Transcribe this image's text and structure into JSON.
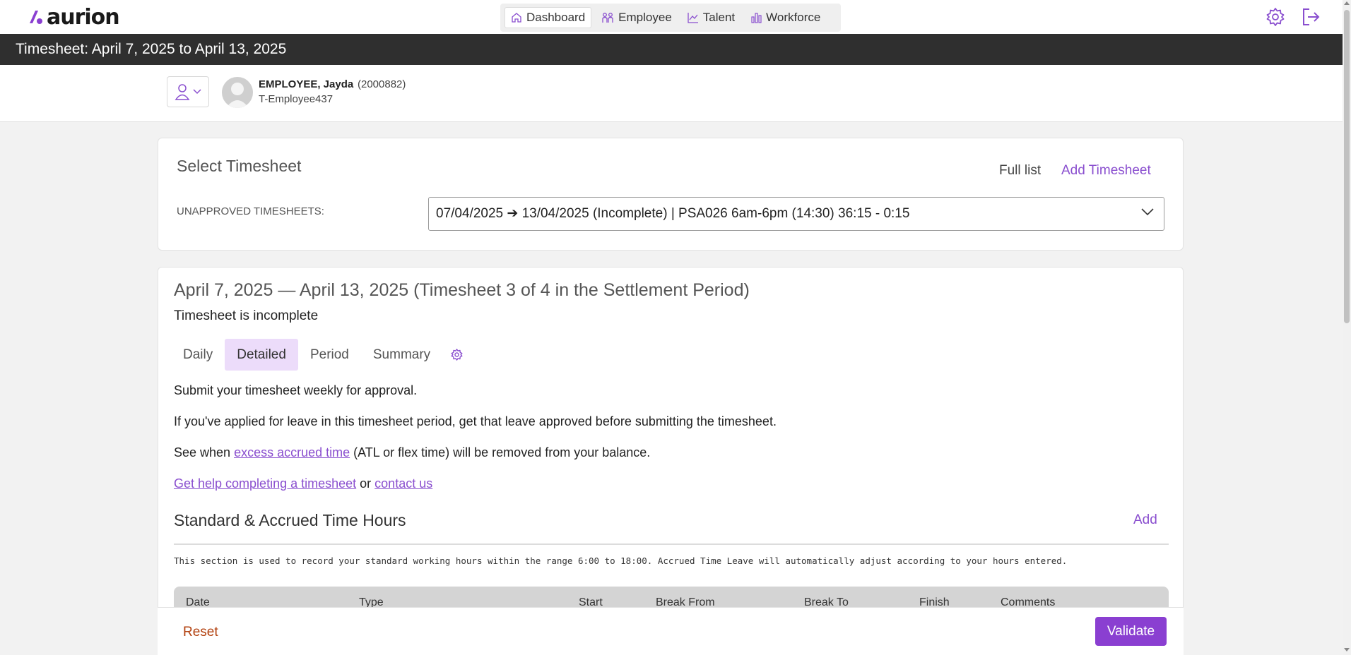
{
  "brand": {
    "logo_text": "aurion",
    "accent": "#8a4fcf",
    "button_color": "#8a3fd1"
  },
  "nav": {
    "items": [
      {
        "label": "Dashboard",
        "icon": "home-icon",
        "active": true
      },
      {
        "label": "Employee",
        "icon": "people-icon",
        "active": false
      },
      {
        "label": "Talent",
        "icon": "trend-chart-icon",
        "active": false
      },
      {
        "label": "Workforce",
        "icon": "bar-chart-icon",
        "active": false
      }
    ],
    "settings_icon": "gear-icon",
    "logout_icon": "logout-icon"
  },
  "page_title": "Timesheet: April 7, 2025 to April 13, 2025",
  "employee": {
    "name": "EMPLOYEE, Jayda",
    "id": "(2000882)",
    "code": "T-Employee437"
  },
  "select_timesheet": {
    "title": "Select Timesheet",
    "full_list": "Full list",
    "add_timesheet": "Add Timesheet",
    "unapproved_label": "UNAPPROVED TIMESHEETS:",
    "selected": "07/04/2025 ➔ 13/04/2025 (Incomplete) | PSA026 6am-6pm (14:30) 36:15 - 0:15"
  },
  "timesheet": {
    "title": "April 7, 2025 — April 13, 2025 (Timesheet 3 of 4 in the Settlement Period)",
    "status": "Timesheet is incomplete",
    "tabs": [
      {
        "label": "Daily",
        "active": false
      },
      {
        "label": "Detailed",
        "active": true
      },
      {
        "label": "Period",
        "active": false
      },
      {
        "label": "Summary",
        "active": false
      }
    ],
    "info": {
      "line1": "Submit your timesheet weekly for approval.",
      "line2": "If you've applied for leave in this timesheet period, get that leave approved before submitting the timesheet.",
      "line3_prefix": "See when ",
      "line3_link": "excess accrued time",
      "line3_suffix": " (ATL or flex time) will be removed from your balance.",
      "help_link": "Get help completing a timesheet",
      "or": " or ",
      "contact_link": "contact us"
    },
    "section": {
      "title": "Standard & Accrued Time Hours",
      "add": "Add",
      "note": "This section is used to record your standard working hours within the range 6:00 to 18:00.  Accrued Time Leave will automatically adjust according to your hours entered.",
      "columns": [
        "Date",
        "Type",
        "Start",
        "Break From",
        "Break To",
        "Finish",
        "Comments"
      ]
    }
  },
  "actions": {
    "reset": "Reset",
    "validate": "Validate"
  }
}
